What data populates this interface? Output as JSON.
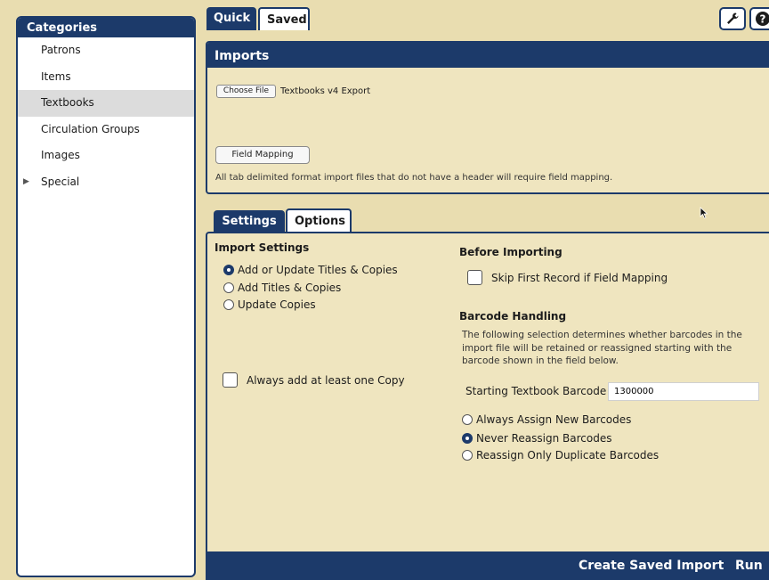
{
  "sidebar": {
    "title": "Categories",
    "items": [
      {
        "label": "Patrons"
      },
      {
        "label": "Items"
      },
      {
        "label": "Textbooks",
        "selected": true
      },
      {
        "label": "Circulation Groups"
      },
      {
        "label": "Images"
      },
      {
        "label": "Special",
        "expandable": true
      }
    ]
  },
  "top_tabs": {
    "quick": "Quick",
    "saved": "Saved"
  },
  "toolbar_icons": [
    "wrench-icon",
    "help-icon"
  ],
  "imports": {
    "title": "Imports",
    "choose_file_label": "Choose File",
    "file_name": "Textbooks v4 Export",
    "field_mapping_label": "Field Mapping",
    "note": "All tab delimited format import files that do not have a header will require field mapping."
  },
  "settings_tabs": {
    "settings": "Settings",
    "options": "Options"
  },
  "import_settings": {
    "title": "Import Settings",
    "options": [
      {
        "label": "Add or Update Titles & Copies",
        "selected": true
      },
      {
        "label": "Add Titles & Copies",
        "selected": false
      },
      {
        "label": "Update Copies",
        "selected": false
      }
    ],
    "always_add_copy_label": "Always add at least one Copy",
    "always_add_copy_checked": false
  },
  "before_importing": {
    "title": "Before Importing",
    "skip_first_record_label": "Skip First Record if Field Mapping",
    "skip_first_record_checked": false
  },
  "barcode_handling": {
    "title": "Barcode Handling",
    "description": "The following selection determines whether barcodes in the import file will be retained or reassigned starting with the barcode shown in the field below.",
    "starting_label": "Starting Textbook Barcode",
    "starting_value": "1300000",
    "options": [
      {
        "label": "Always Assign New Barcodes",
        "selected": false
      },
      {
        "label": "Never Reassign Barcodes",
        "selected": true
      },
      {
        "label": "Reassign Only Duplicate Barcodes",
        "selected": false
      }
    ]
  },
  "footer": {
    "create_saved_import": "Create Saved Import",
    "run": "Run"
  },
  "colors": {
    "navy": "#1c3a6a",
    "panel": "#efe5bf",
    "background": "#e9ddb0"
  }
}
